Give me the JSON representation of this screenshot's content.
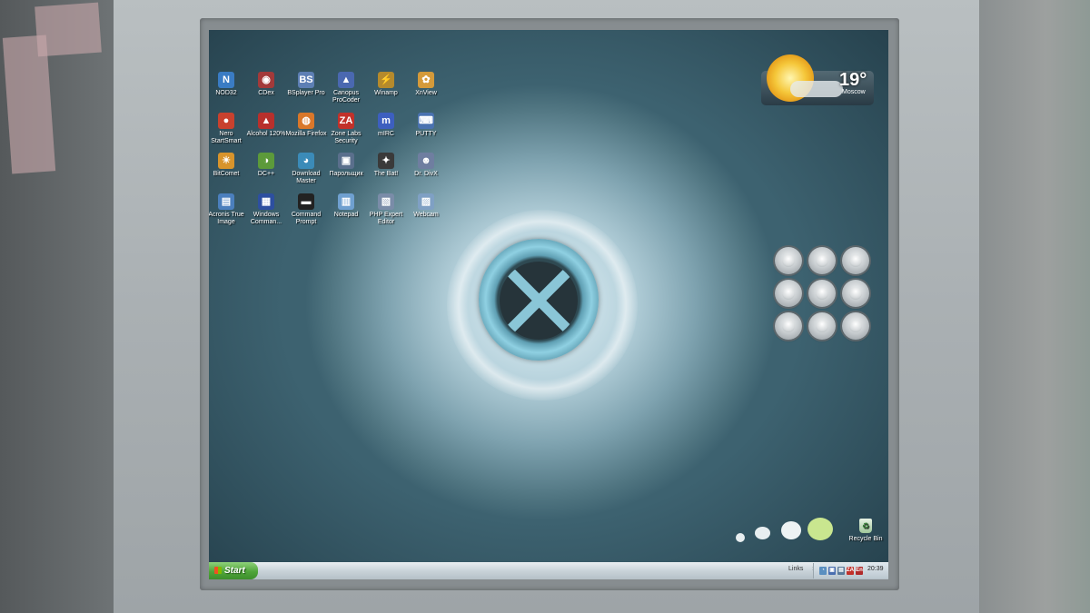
{
  "desktop": {
    "icons": [
      {
        "label": "NOD32",
        "glyph": "N",
        "color": "#3a7cc4"
      },
      {
        "label": "CDex",
        "glyph": "◉",
        "color": "#a33a3a"
      },
      {
        "label": "BSplayer Pro",
        "glyph": "BS",
        "color": "#5d7fb4"
      },
      {
        "label": "Canopus ProCoder",
        "glyph": "▲",
        "color": "#4a68b0"
      },
      {
        "label": "Winamp",
        "glyph": "⚡",
        "color": "#b58a2c"
      },
      {
        "label": "XnView",
        "glyph": "✿",
        "color": "#d49a3a"
      },
      {
        "label": "Nero StartSmart",
        "glyph": "●",
        "color": "#c8412e"
      },
      {
        "label": "Alcohol 120%",
        "glyph": "▲",
        "color": "#b8302c"
      },
      {
        "label": "Mozilla Firefox",
        "glyph": "◍",
        "color": "#d9772a"
      },
      {
        "label": "Zone Labs Security",
        "glyph": "ZA",
        "color": "#c2312a"
      },
      {
        "label": "mIRC",
        "glyph": "m",
        "color": "#3d5fbf"
      },
      {
        "label": "PUTTY",
        "glyph": "⌨",
        "color": "#4a72b0"
      },
      {
        "label": "BitComet",
        "glyph": "☀",
        "color": "#d8942c"
      },
      {
        "label": "DC++",
        "glyph": "◑",
        "color": "#5c9a3a"
      },
      {
        "label": "Download Master",
        "glyph": "◕",
        "color": "#3b8bb8"
      },
      {
        "label": "Парольщик",
        "glyph": "▣",
        "color": "#5a6f8c"
      },
      {
        "label": "The Bat!",
        "glyph": "✦",
        "color": "#3a3a3a"
      },
      {
        "label": "Dr. DivX",
        "glyph": "☻",
        "color": "#6f7ea0"
      },
      {
        "label": "Acronis True Image",
        "glyph": "▤",
        "color": "#4b7fbd"
      },
      {
        "label": "Windows Comman...",
        "glyph": "▦",
        "color": "#2d4fa0"
      },
      {
        "label": "Command Prompt",
        "glyph": "▬",
        "color": "#222222"
      },
      {
        "label": "Notepad",
        "glyph": "▥",
        "color": "#6fa0d0"
      },
      {
        "label": "PHP Expert Editor",
        "glyph": "▧",
        "color": "#7a8ca8"
      },
      {
        "label": "Webcam",
        "glyph": "▨",
        "color": "#7fa0c4"
      }
    ]
  },
  "weather": {
    "temperature": "19°",
    "city": "Moscow"
  },
  "recycle_bin": {
    "label": "Recycle Bin",
    "glyph": "♻"
  },
  "taskbar": {
    "start_label": "Start",
    "links_label": "Links",
    "chevron": "»",
    "clock": "20:39",
    "tray_icons": [
      {
        "glyph": "◔",
        "color": "#5a8fc0"
      },
      {
        "glyph": "▣",
        "color": "#4a6fb0"
      },
      {
        "glyph": "▤",
        "color": "#5a7a9a"
      },
      {
        "glyph": "ZA",
        "color": "#c2312a"
      },
      {
        "glyph": "En",
        "color": "#b02a2a"
      }
    ]
  },
  "colors": {
    "start_green": "#4fa53a",
    "taskbar_bg": "#c9d3d9",
    "desktop_accent": "#3d6270"
  }
}
